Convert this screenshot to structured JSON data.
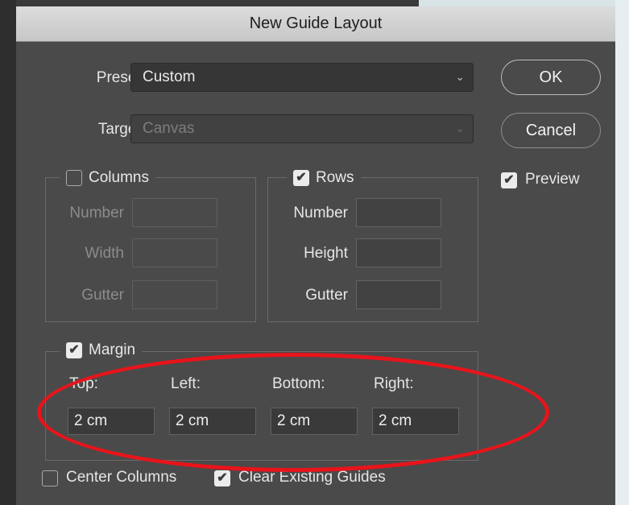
{
  "dialog": {
    "title": "New Guide Layout",
    "preset": {
      "label": "Preset:",
      "value": "Custom"
    },
    "target": {
      "label": "Target:",
      "value": "Canvas"
    },
    "buttons": {
      "ok": "OK",
      "cancel": "Cancel"
    },
    "preview": {
      "label": "Preview",
      "checked": true
    },
    "columns": {
      "label": "Columns",
      "checked": false,
      "fields": [
        {
          "label": "Number",
          "value": ""
        },
        {
          "label": "Width",
          "value": ""
        },
        {
          "label": "Gutter",
          "value": ""
        }
      ]
    },
    "rows": {
      "label": "Rows",
      "checked": true,
      "fields": [
        {
          "label": "Number",
          "value": ""
        },
        {
          "label": "Height",
          "value": ""
        },
        {
          "label": "Gutter",
          "value": ""
        }
      ]
    },
    "margin": {
      "label": "Margin",
      "checked": true,
      "fields": [
        {
          "label": "Top:",
          "value": "2 cm"
        },
        {
          "label": "Left:",
          "value": "2 cm"
        },
        {
          "label": "Bottom:",
          "value": "2 cm"
        },
        {
          "label": "Right:",
          "value": "2 cm"
        }
      ]
    },
    "center_columns": {
      "label": "Center Columns",
      "checked": false
    },
    "clear_existing_guides": {
      "label": "Clear Existing Guides",
      "checked": true
    }
  },
  "icons": {
    "checkmark": "✔",
    "chevron": "⌄"
  },
  "colors": {
    "annotation": "#e8141b",
    "title_bar": "#d3d3d3",
    "panel": "#4a4a4a"
  }
}
